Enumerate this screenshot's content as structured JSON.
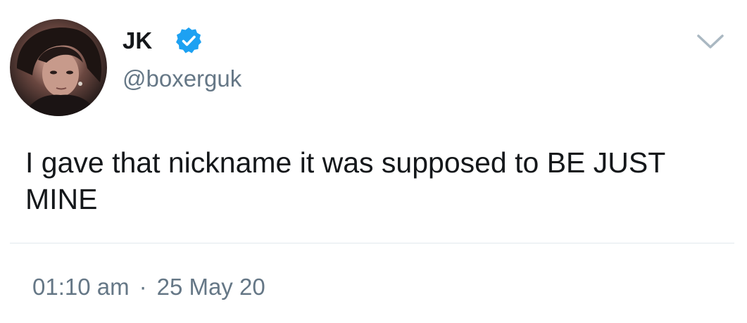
{
  "tweet": {
    "display_name": "JK",
    "verified": true,
    "handle": "@boxerguk",
    "text": "I gave that nickname it was supposed to BE JUST MINE",
    "time": "01:10 am",
    "separator": "·",
    "date": "25 May 20"
  },
  "icons": {
    "verified": "verified-badge-icon",
    "menu": "chevron-down-icon"
  },
  "colors": {
    "verified_blue": "#1da1f2",
    "text_primary": "#14171a",
    "text_secondary": "#657786",
    "divider": "#e1e8ed"
  }
}
